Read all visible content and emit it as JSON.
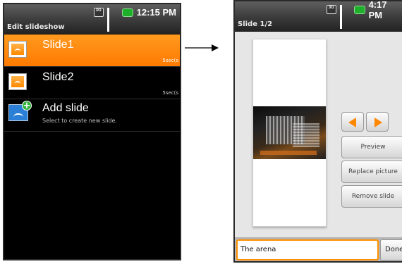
{
  "left_screen": {
    "status": {
      "time": "12:15 PM",
      "network_icon": "3g-icon",
      "signal_icon": "signal-icon",
      "battery_icon": "battery-icon"
    },
    "title": "Edit slideshow",
    "slides": [
      {
        "label": "Slide1",
        "duration": "5sec(s",
        "selected": true
      },
      {
        "label": "Slide2",
        "duration": "5sec(s",
        "selected": false
      }
    ],
    "add_slide": {
      "label": "Add slide",
      "subtitle": "Select to create new slide."
    }
  },
  "right_screen": {
    "status": {
      "time": "4:17 PM"
    },
    "title": "Slide 1/2",
    "buttons": {
      "prev_icon": "arrow-left-icon",
      "next_icon": "arrow-right-icon",
      "preview": "Preview",
      "replace": "Replace picture",
      "remove": "Remove slide",
      "done": "Done"
    },
    "caption": {
      "value": "The arena"
    }
  },
  "colors": {
    "accent": "#ff8800",
    "battery": "#1fb02b"
  }
}
